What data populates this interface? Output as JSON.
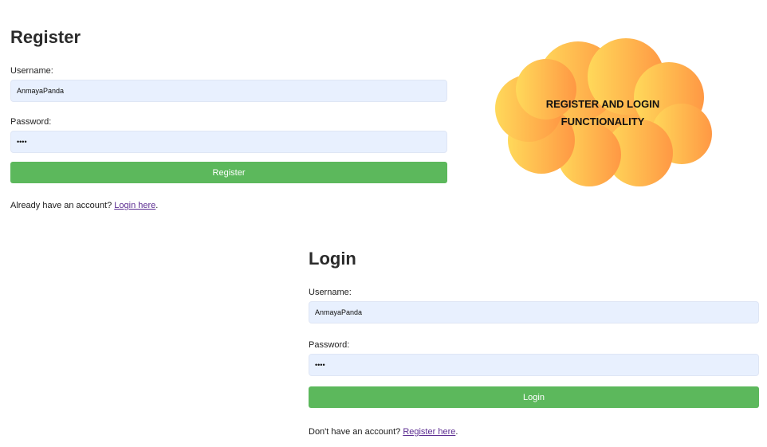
{
  "register": {
    "title": "Register",
    "username_label": "Username:",
    "username_value": "AnmayaPanda",
    "password_label": "Password:",
    "password_value": "••••",
    "button_label": "Register",
    "switch_prefix": "Already have an account?",
    "switch_link": "Login here",
    "switch_suffix": "."
  },
  "login": {
    "title": "Login",
    "username_label": "Username:",
    "username_value": "AnmayaPanda",
    "password_label": "Password:",
    "password_value": "••••",
    "button_label": "Login",
    "switch_prefix": "Don't have an account?",
    "switch_link": "Register here",
    "switch_suffix": "."
  },
  "callout": {
    "line1": "REGISTER AND LOGIN",
    "line2": "FUNCTIONALITY"
  },
  "colors": {
    "button_green": "#5cb85c",
    "input_background": "#e8f0fe",
    "link_purple": "#5b2c91",
    "cloud_gradient_start": "#ffd95a",
    "cloud_gradient_end": "#ff9844"
  }
}
